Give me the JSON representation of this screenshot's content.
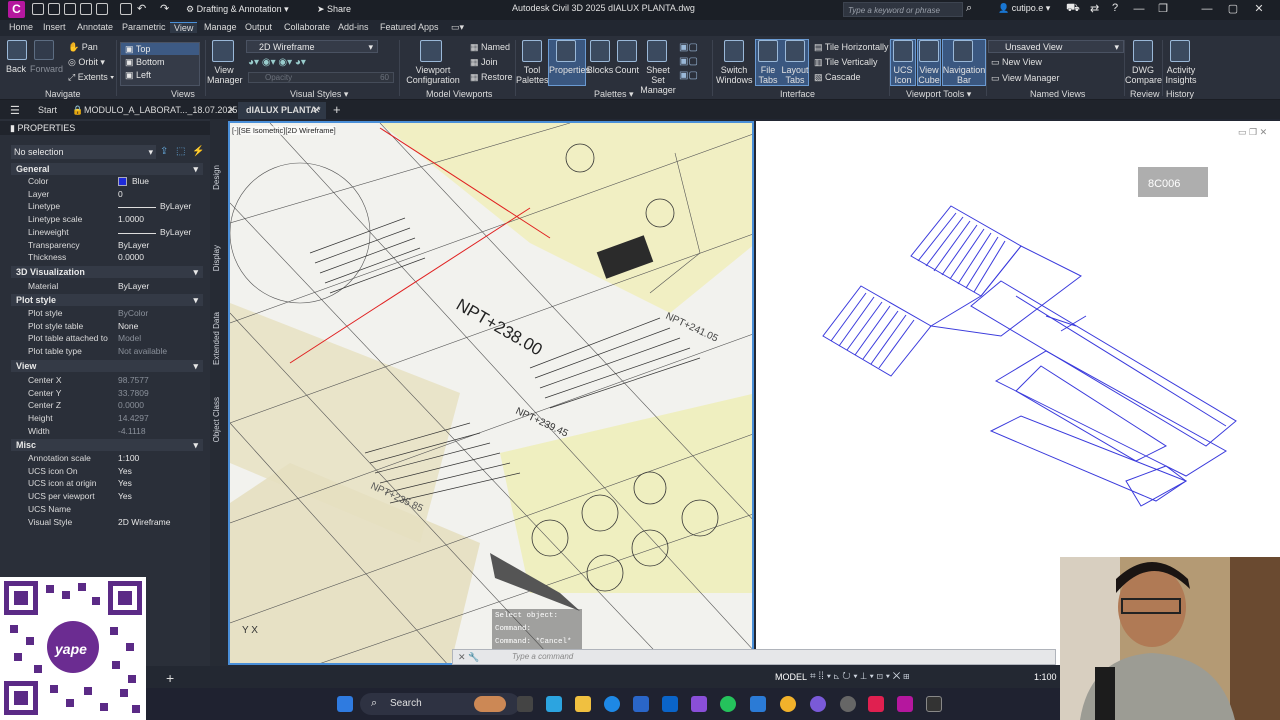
{
  "window": {
    "app_icon": "C",
    "workspace": "Drafting & Annotation",
    "share": "Share",
    "title": "Autodesk Civil 3D 2025    dIALUX PLANTA.dwg",
    "search_placeholder": "Type a keyword or phrase",
    "user": "cutipo.e"
  },
  "ribbon_tabs": [
    "Home",
    "Insert",
    "Annotate",
    "Parametric",
    "View",
    "Manage",
    "Output",
    "Collaborate",
    "Add-ins",
    "Featured Apps"
  ],
  "ribbon": {
    "navigate": {
      "back": "Back",
      "forward": "Forward",
      "pan": "Pan",
      "orbit": "Orbit",
      "extents": "Extents",
      "group": "Navigate"
    },
    "views": {
      "items": [
        "Top",
        "Bottom",
        "Left"
      ],
      "group": "Views"
    },
    "visual_styles": {
      "current": "2D Wireframe",
      "view_manager": "View Manager",
      "opacity": "Opacity",
      "opacity_value": "60",
      "group": "Visual Styles"
    },
    "model_viewports": {
      "config": "Viewport Configuration",
      "named": "Named",
      "join": "Join",
      "restore": "Restore",
      "group": "Model Viewports"
    },
    "palettes": {
      "tool_palettes": "Tool Palettes",
      "properties": "Properties",
      "blocks": "Blocks",
      "count": "Count",
      "sheet_set": "Sheet Set Manager",
      "group": "Palettes"
    },
    "interface": {
      "switch_windows": "Switch Windows",
      "file_tabs": "File Tabs",
      "layout_tabs": "Layout Tabs",
      "tile_h": "Tile Horizontally",
      "tile_v": "Tile Vertically",
      "cascade": "Cascade",
      "group": "Interface"
    },
    "viewport_tools": {
      "ucs_icon": "UCS Icon",
      "view_cube": "View Cube",
      "nav_bar": "Navigation Bar",
      "group": "Viewport Tools"
    },
    "named_views": {
      "current": "Unsaved View",
      "new_view": "New View",
      "view_manager": "View Manager",
      "group": "Named Views"
    },
    "review": {
      "dwg_compare": "DWG Compare",
      "group": "Review"
    },
    "history": {
      "activity": "Activity Insights",
      "group": "History"
    }
  },
  "doc_tabs": {
    "start": "Start",
    "tab1": "MODULO_A_LABORAT..._18.07.2025[1]*",
    "tab2": "dIALUX PLANTA*"
  },
  "properties": {
    "title": "PROPERTIES",
    "selection": "No selection",
    "sections": {
      "general": "General",
      "viz3d": "3D Visualization",
      "plot": "Plot style",
      "view": "View",
      "misc": "Misc"
    },
    "general": [
      [
        "Color",
        "Blue"
      ],
      [
        "Layer",
        "0"
      ],
      [
        "Linetype",
        "ByLayer"
      ],
      [
        "Linetype scale",
        "1.0000"
      ],
      [
        "Lineweight",
        "ByLayer"
      ],
      [
        "Transparency",
        "ByLayer"
      ],
      [
        "Thickness",
        "0.0000"
      ]
    ],
    "viz3d": [
      [
        "Material",
        "ByLayer"
      ]
    ],
    "plot": [
      [
        "Plot style",
        "ByColor"
      ],
      [
        "Plot style table",
        "None"
      ],
      [
        "Plot table attached to",
        "Model"
      ],
      [
        "Plot table type",
        "Not available"
      ]
    ],
    "view": [
      [
        "Center X",
        "98.7577"
      ],
      [
        "Center Y",
        "33.7809"
      ],
      [
        "Center Z",
        "0.0000"
      ],
      [
        "Height",
        "14.4297"
      ],
      [
        "Width",
        "-4.1118"
      ]
    ],
    "misc": [
      [
        "Annotation scale",
        "1:100"
      ],
      [
        "UCS icon On",
        "Yes"
      ],
      [
        "UCS icon at origin",
        "Yes"
      ],
      [
        "UCS per viewport",
        "Yes"
      ],
      [
        "UCS Name",
        ""
      ],
      [
        "Visual Style",
        "2D Wireframe"
      ]
    ],
    "side_tabs": [
      "Design",
      "Display",
      "Extended Data",
      "Object Class"
    ]
  },
  "viewport": {
    "label": "[-][SE Isometric][2D Wireframe]",
    "npt1": "NPT+238.00",
    "npt2": "NPT+239.45",
    "npt3": "NPT+241.05",
    "npt4": "NPT+235.85",
    "right_label": "8C006"
  },
  "command": {
    "line1": "Select object:",
    "line2": "Command:",
    "line3": "Command: *Cancel*",
    "placeholder": "Type a command"
  },
  "status": {
    "model": "MODEL",
    "scale": "1:100"
  },
  "taskbar": {
    "search": "Search"
  },
  "overlay": {
    "qr_brand": "yape"
  },
  "colors": {
    "accent": "#4a8fd8",
    "selection_blue": "#3a3adc",
    "app_icon": "#b5179e"
  }
}
